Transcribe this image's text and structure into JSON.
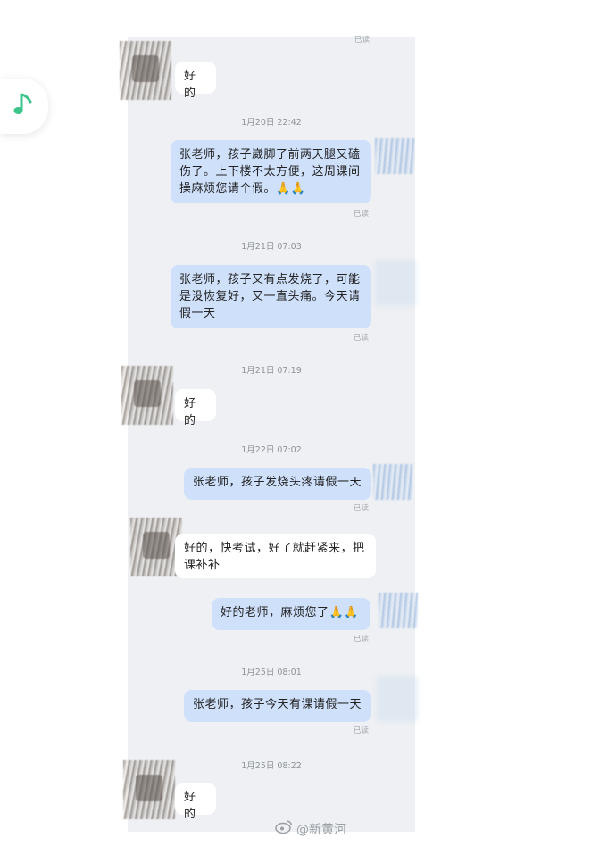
{
  "chat": {
    "messages": [
      {
        "side": "in",
        "text": "好的"
      },
      {
        "side": "out",
        "text": "张老师，孩子崴脚了前两天腿又磕伤了。上下楼不太方便，这周课间操麻烦您请个假。🙏🙏"
      },
      {
        "side": "out",
        "text": "张老师，孩子又有点发烧了，可能是没恢复好，又一直头痛。今天请假一天"
      },
      {
        "side": "in",
        "text": "好的"
      },
      {
        "side": "out",
        "text": "张老师，孩子发烧头疼请假一天"
      },
      {
        "side": "in",
        "text": "好的，快考试，好了就赶紧来，把课补补"
      },
      {
        "side": "out",
        "text": "好的老师，麻烦您了🙏🙏"
      },
      {
        "side": "out",
        "text": "张老师，孩子今天有课请假一天"
      },
      {
        "side": "in",
        "text": "好的"
      }
    ],
    "timestamps": [
      "1月20日 22:42",
      "1月21日 07:03",
      "1月21日 07:19",
      "1月22日 07:02",
      "1月25日 08:01",
      "1月25日 08:22"
    ],
    "read_label": "已读"
  },
  "watermark": {
    "text": "@新黄河",
    "icon": "weibo-icon"
  },
  "music_badge": {
    "icon": "music-note-icon",
    "color": "#3cc58b"
  }
}
